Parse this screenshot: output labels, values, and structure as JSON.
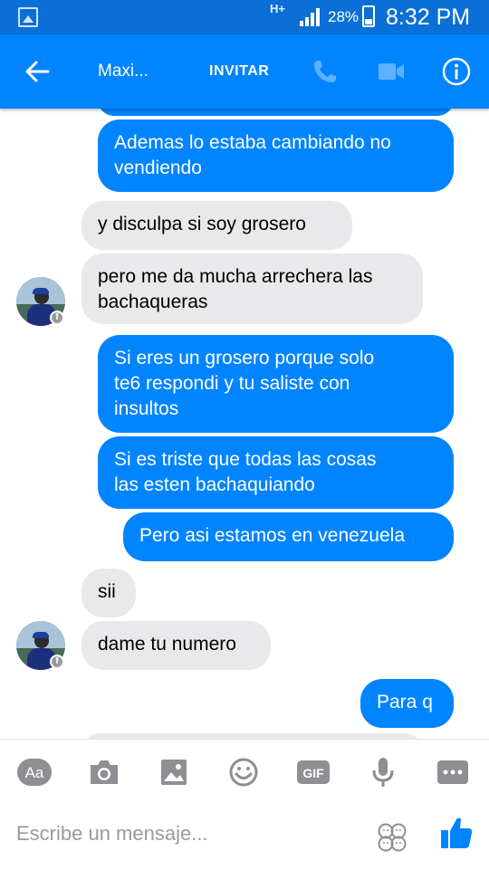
{
  "status_bar": {
    "network": "H+",
    "battery": "28%",
    "time": "8:32 PM"
  },
  "header": {
    "contact_name": "Maxi...",
    "invite_label": "INVITAR"
  },
  "messages": [
    {
      "side": "out",
      "text": "Ademas lo estaba cambiando no\nvendiendo"
    },
    {
      "side": "in",
      "text": "y disculpa si soy grosero"
    },
    {
      "side": "in",
      "text": "pero me da mucha arrechera las\nbachaqueras"
    },
    {
      "side": "out",
      "text": "Si eres un grosero porque solo\nte6 respondi y tu saliste con\ninsultos"
    },
    {
      "side": "out",
      "text": "Si es triste que todas las cosas\nlas esten bachaquiando"
    },
    {
      "side": "out",
      "text": "Pero asi estamos en venezuela"
    },
    {
      "side": "in",
      "text": "sii"
    },
    {
      "side": "in",
      "text": "dame tu numero"
    },
    {
      "side": "out",
      "text": "Para q"
    }
  ],
  "toolbar": {
    "text_label": "Aa",
    "gif_label": "GIF",
    "icons": [
      "text-format-icon",
      "camera-icon",
      "gallery-icon",
      "emoji-icon",
      "gif-icon",
      "microphone-icon",
      "more-icon"
    ]
  },
  "composer": {
    "placeholder": "Escribe un mensaje..."
  },
  "colors": {
    "accent": "#0084ff",
    "status_bar": "#0a6fd6",
    "incoming": "#e9e9eb",
    "toolbar_icon": "#8e8e93"
  }
}
